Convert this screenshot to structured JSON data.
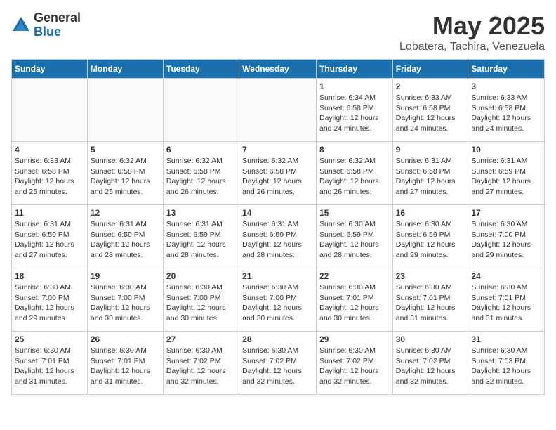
{
  "logo": {
    "general": "General",
    "blue": "Blue"
  },
  "title": "May 2025",
  "subtitle": "Lobatera, Tachira, Venezuela",
  "weekdays": [
    "Sunday",
    "Monday",
    "Tuesday",
    "Wednesday",
    "Thursday",
    "Friday",
    "Saturday"
  ],
  "weeks": [
    [
      {
        "day": "",
        "info": ""
      },
      {
        "day": "",
        "info": ""
      },
      {
        "day": "",
        "info": ""
      },
      {
        "day": "",
        "info": ""
      },
      {
        "day": "1",
        "info": "Sunrise: 6:34 AM\nSunset: 6:58 PM\nDaylight: 12 hours\nand 24 minutes."
      },
      {
        "day": "2",
        "info": "Sunrise: 6:33 AM\nSunset: 6:58 PM\nDaylight: 12 hours\nand 24 minutes."
      },
      {
        "day": "3",
        "info": "Sunrise: 6:33 AM\nSunset: 6:58 PM\nDaylight: 12 hours\nand 24 minutes."
      }
    ],
    [
      {
        "day": "4",
        "info": "Sunrise: 6:33 AM\nSunset: 6:58 PM\nDaylight: 12 hours\nand 25 minutes."
      },
      {
        "day": "5",
        "info": "Sunrise: 6:32 AM\nSunset: 6:58 PM\nDaylight: 12 hours\nand 25 minutes."
      },
      {
        "day": "6",
        "info": "Sunrise: 6:32 AM\nSunset: 6:58 PM\nDaylight: 12 hours\nand 26 minutes."
      },
      {
        "day": "7",
        "info": "Sunrise: 6:32 AM\nSunset: 6:58 PM\nDaylight: 12 hours\nand 26 minutes."
      },
      {
        "day": "8",
        "info": "Sunrise: 6:32 AM\nSunset: 6:58 PM\nDaylight: 12 hours\nand 26 minutes."
      },
      {
        "day": "9",
        "info": "Sunrise: 6:31 AM\nSunset: 6:58 PM\nDaylight: 12 hours\nand 27 minutes."
      },
      {
        "day": "10",
        "info": "Sunrise: 6:31 AM\nSunset: 6:59 PM\nDaylight: 12 hours\nand 27 minutes."
      }
    ],
    [
      {
        "day": "11",
        "info": "Sunrise: 6:31 AM\nSunset: 6:59 PM\nDaylight: 12 hours\nand 27 minutes."
      },
      {
        "day": "12",
        "info": "Sunrise: 6:31 AM\nSunset: 6:59 PM\nDaylight: 12 hours\nand 28 minutes."
      },
      {
        "day": "13",
        "info": "Sunrise: 6:31 AM\nSunset: 6:59 PM\nDaylight: 12 hours\nand 28 minutes."
      },
      {
        "day": "14",
        "info": "Sunrise: 6:31 AM\nSunset: 6:59 PM\nDaylight: 12 hours\nand 28 minutes."
      },
      {
        "day": "15",
        "info": "Sunrise: 6:30 AM\nSunset: 6:59 PM\nDaylight: 12 hours\nand 28 minutes."
      },
      {
        "day": "16",
        "info": "Sunrise: 6:30 AM\nSunset: 6:59 PM\nDaylight: 12 hours\nand 29 minutes."
      },
      {
        "day": "17",
        "info": "Sunrise: 6:30 AM\nSunset: 7:00 PM\nDaylight: 12 hours\nand 29 minutes."
      }
    ],
    [
      {
        "day": "18",
        "info": "Sunrise: 6:30 AM\nSunset: 7:00 PM\nDaylight: 12 hours\nand 29 minutes."
      },
      {
        "day": "19",
        "info": "Sunrise: 6:30 AM\nSunset: 7:00 PM\nDaylight: 12 hours\nand 30 minutes."
      },
      {
        "day": "20",
        "info": "Sunrise: 6:30 AM\nSunset: 7:00 PM\nDaylight: 12 hours\nand 30 minutes."
      },
      {
        "day": "21",
        "info": "Sunrise: 6:30 AM\nSunset: 7:00 PM\nDaylight: 12 hours\nand 30 minutes."
      },
      {
        "day": "22",
        "info": "Sunrise: 6:30 AM\nSunset: 7:01 PM\nDaylight: 12 hours\nand 30 minutes."
      },
      {
        "day": "23",
        "info": "Sunrise: 6:30 AM\nSunset: 7:01 PM\nDaylight: 12 hours\nand 31 minutes."
      },
      {
        "day": "24",
        "info": "Sunrise: 6:30 AM\nSunset: 7:01 PM\nDaylight: 12 hours\nand 31 minutes."
      }
    ],
    [
      {
        "day": "25",
        "info": "Sunrise: 6:30 AM\nSunset: 7:01 PM\nDaylight: 12 hours\nand 31 minutes."
      },
      {
        "day": "26",
        "info": "Sunrise: 6:30 AM\nSunset: 7:01 PM\nDaylight: 12 hours\nand 31 minutes."
      },
      {
        "day": "27",
        "info": "Sunrise: 6:30 AM\nSunset: 7:02 PM\nDaylight: 12 hours\nand 32 minutes."
      },
      {
        "day": "28",
        "info": "Sunrise: 6:30 AM\nSunset: 7:02 PM\nDaylight: 12 hours\nand 32 minutes."
      },
      {
        "day": "29",
        "info": "Sunrise: 6:30 AM\nSunset: 7:02 PM\nDaylight: 12 hours\nand 32 minutes."
      },
      {
        "day": "30",
        "info": "Sunrise: 6:30 AM\nSunset: 7:02 PM\nDaylight: 12 hours\nand 32 minutes."
      },
      {
        "day": "31",
        "info": "Sunrise: 6:30 AM\nSunset: 7:03 PM\nDaylight: 12 hours\nand 32 minutes."
      }
    ]
  ]
}
